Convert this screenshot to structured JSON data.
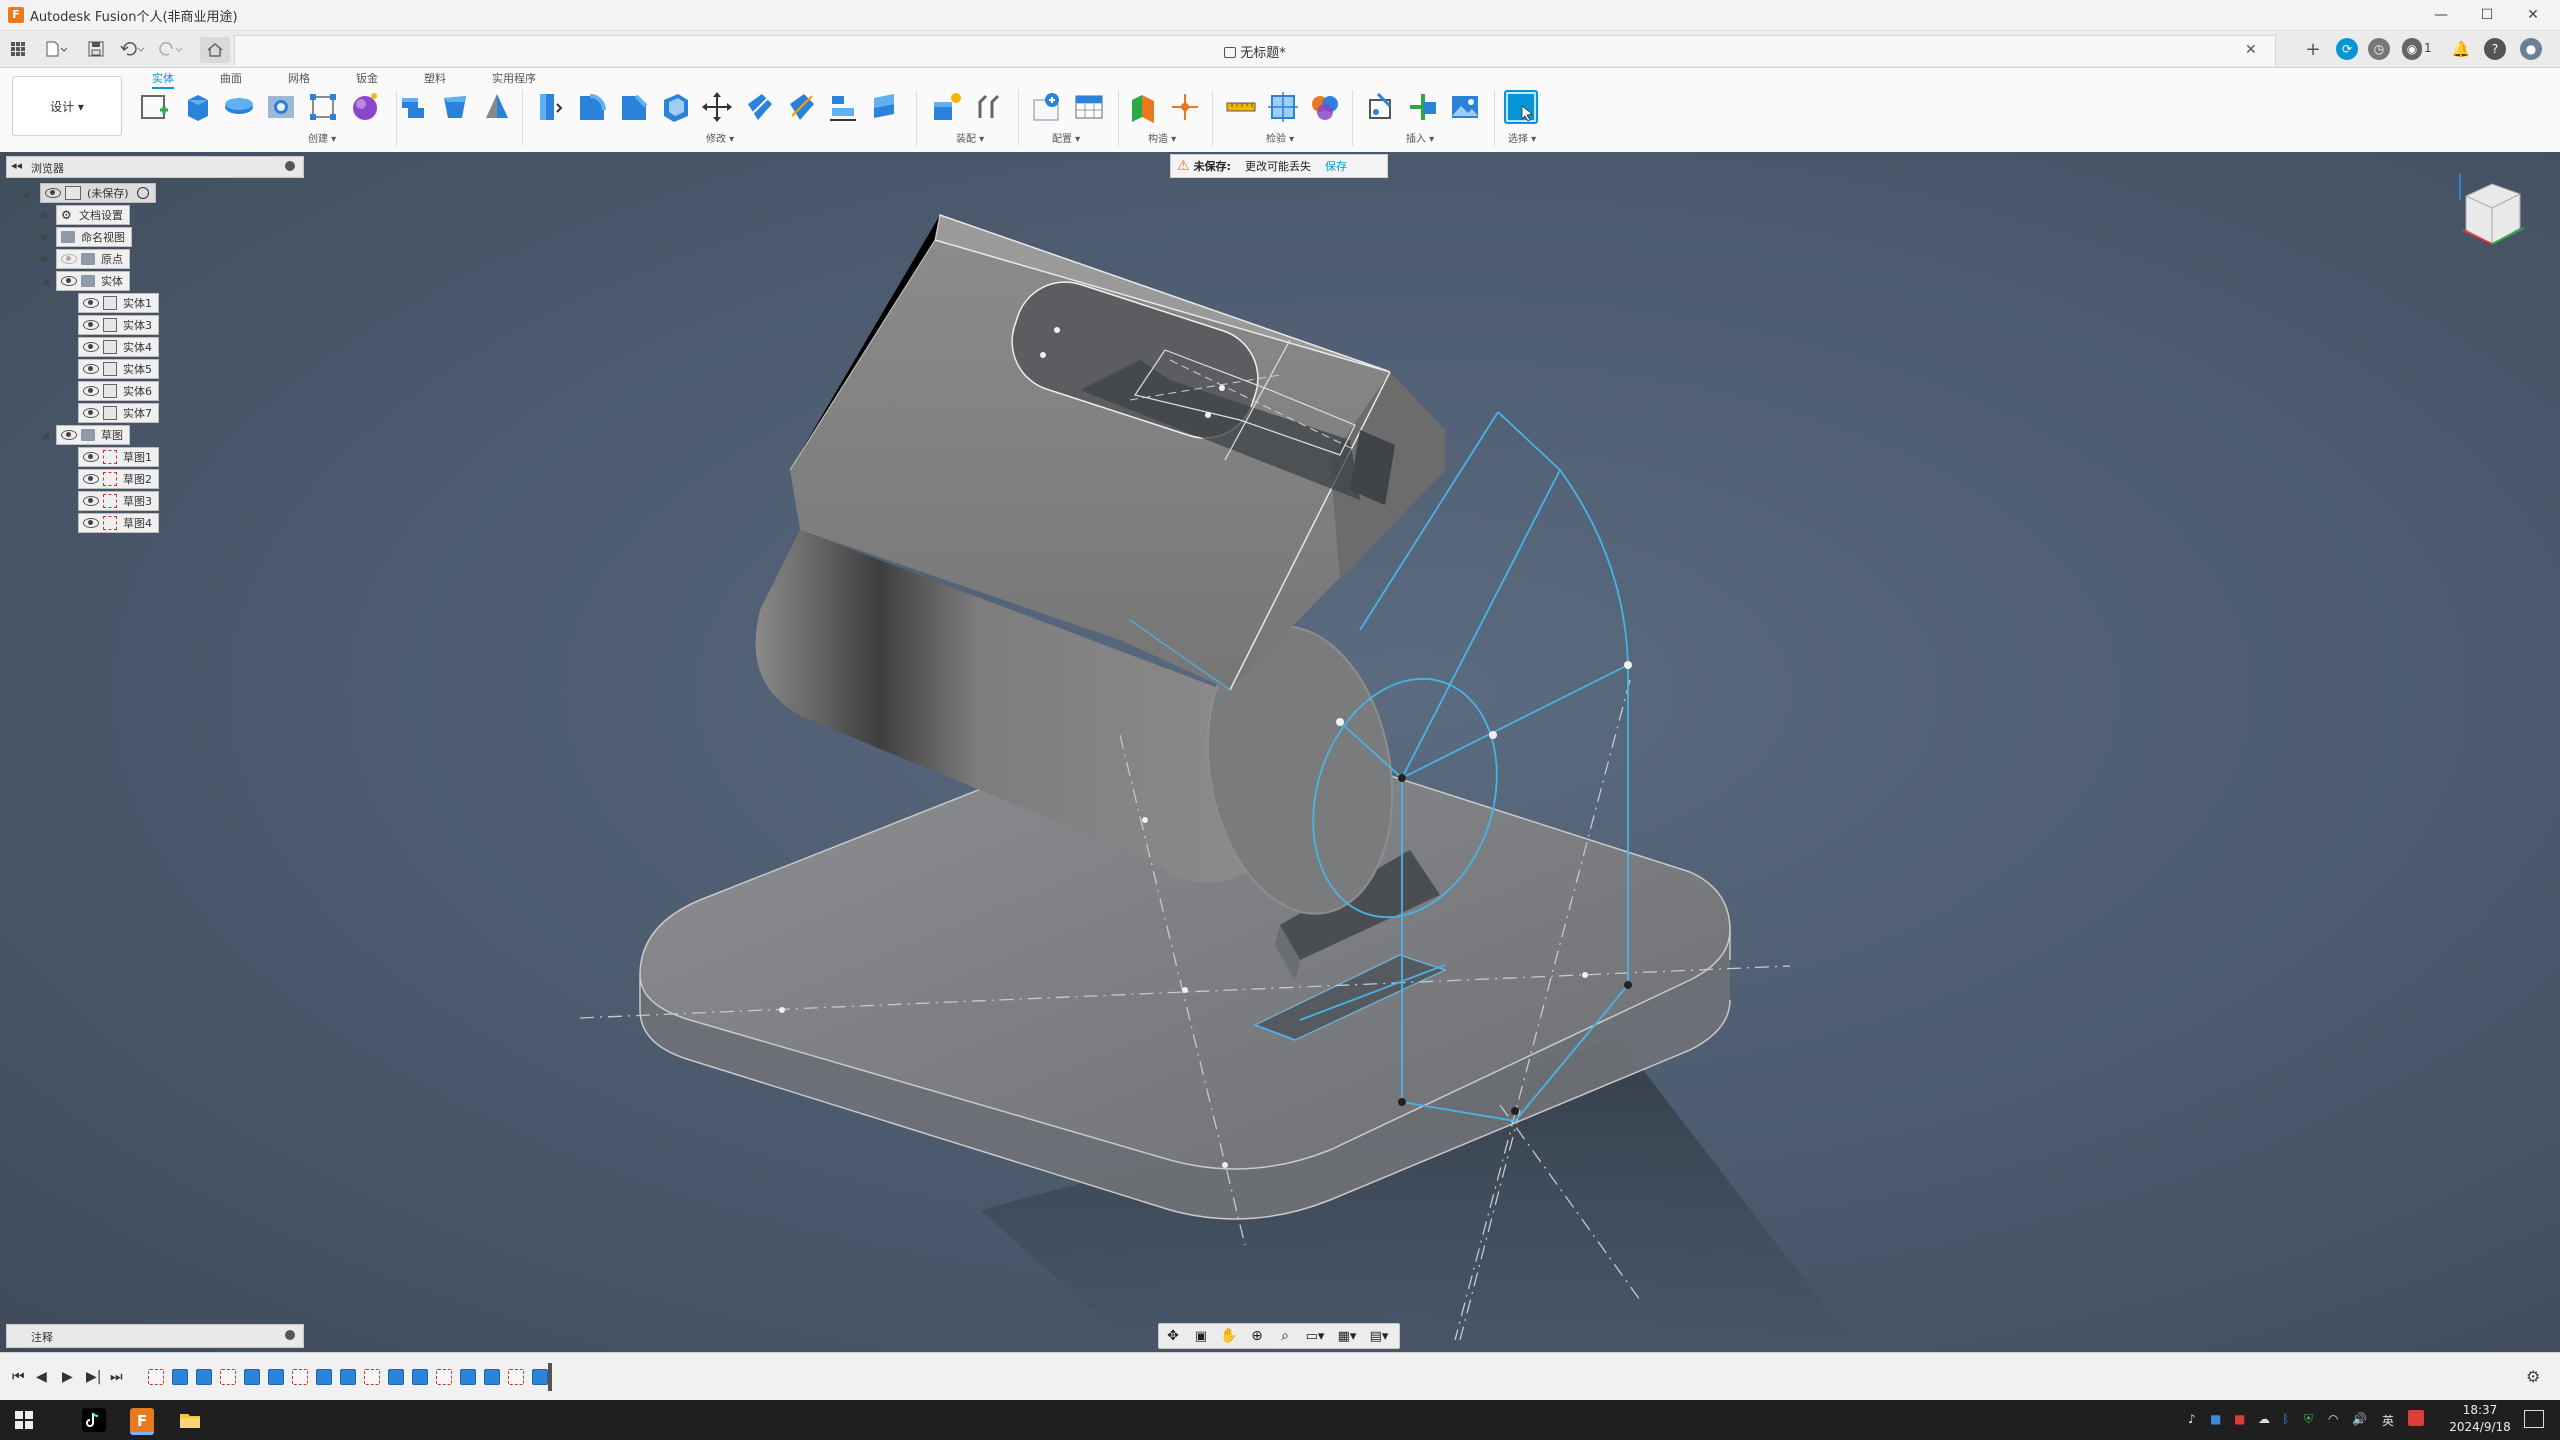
{
  "window": {
    "title": "Autodesk Fusion个人(非商业用途)",
    "logo_letter": "F",
    "controls": [
      "—",
      "☐",
      "✕"
    ]
  },
  "tabbar": {
    "doc_title": "无标题*",
    "lock_icon": "lock-icon",
    "close": "✕",
    "quick_icons": [
      "grid-icon",
      "file-icon",
      "save-icon",
      "undo-icon",
      "redo-icon"
    ],
    "home_icon": "home-icon",
    "right_icons": [
      "plus-icon",
      "sync-icon",
      "clock-icon",
      "jobs-icon",
      "bell-icon",
      "help-icon",
      "user-icon"
    ],
    "jobs_count": "1"
  },
  "ribbon": {
    "workspace": "设计 ▾",
    "tabs": [
      "实体",
      "曲面",
      "网格",
      "钣金",
      "塑料",
      "实用程序"
    ],
    "active_tab": "实体",
    "groups": [
      {
        "label": "创建 ▾",
        "icons": [
          "sketch-icon",
          "extrude-icon",
          "revolve-icon",
          "hole-icon",
          "pattern-icon",
          "form-icon"
        ]
      },
      {
        "label": "修改 ▾",
        "icons": [
          "sweep-icon",
          "loft-icon",
          "mirror-icon",
          "press-pull-icon",
          "fillet-icon",
          "chamfer-icon",
          "shell-icon",
          "combine-icon",
          "move-icon",
          "split-icon",
          "offset-icon",
          "align-icon",
          "replace-icon"
        ]
      },
      {
        "label": "装配 ▾",
        "icons": [
          "new-component-icon",
          "joint-icon"
        ]
      },
      {
        "label": "配置 ▾",
        "icons": [
          "config-icon",
          "table-icon"
        ]
      },
      {
        "label": "构造 ▾",
        "icons": [
          "plane-icon",
          "point-icon"
        ]
      },
      {
        "label": "检验 ▾",
        "icons": [
          "measure-icon",
          "section-icon",
          "zebra-icon"
        ]
      },
      {
        "label": "插入 ▾",
        "icons": [
          "insert-derive-icon",
          "insert-icon",
          "canvas-icon"
        ]
      },
      {
        "label": "选择 ▾",
        "icons": [
          "select-icon"
        ]
      }
    ]
  },
  "browser": {
    "title": "浏览器",
    "root": "(未保存)",
    "items": [
      {
        "label": "文档设置",
        "level": 1,
        "icon": "gear-icon"
      },
      {
        "label": "命名视图",
        "level": 1,
        "icon": "folder-icon"
      },
      {
        "label": "原点",
        "level": 1,
        "icon": "folder-icon"
      },
      {
        "label": "实体",
        "level": 1,
        "icon": "folder-icon"
      },
      {
        "label": "实体1",
        "level": 2,
        "icon": "body-icon"
      },
      {
        "label": "实体3",
        "level": 2,
        "icon": "body-icon"
      },
      {
        "label": "实体4",
        "level": 2,
        "icon": "body-icon"
      },
      {
        "label": "实体5",
        "level": 2,
        "icon": "body-icon"
      },
      {
        "label": "实体6",
        "level": 2,
        "icon": "body-icon"
      },
      {
        "label": "实体7",
        "level": 2,
        "icon": "body-icon"
      },
      {
        "label": "草图",
        "level": 1,
        "icon": "folder-icon"
      },
      {
        "label": "草图1",
        "level": 2,
        "icon": "sketch-icon"
      },
      {
        "label": "草图2",
        "level": 2,
        "icon": "sketch-icon"
      },
      {
        "label": "草图3",
        "level": 2,
        "icon": "sketch-icon"
      },
      {
        "label": "草图4",
        "level": 2,
        "icon": "sketch-icon"
      }
    ]
  },
  "unsaved_banner": {
    "label": "未保存:",
    "message": "更改可能丢失",
    "action": "保存"
  },
  "comments": {
    "title": "注释"
  },
  "navbar": {
    "icons": [
      "orbit-icon",
      "look-at-icon",
      "pan-icon",
      "zoom-icon",
      "fit-icon",
      "display-icon",
      "grid-icon",
      "viewports-icon"
    ]
  },
  "timeline": {
    "controls": [
      "⏮",
      "◀",
      "▶",
      "▶|",
      "⏭"
    ],
    "feature_count": "17"
  },
  "taskbar": {
    "time": "18:37",
    "date": "2024/9/18",
    "ime": "英",
    "tray_icons": [
      "tiktok-icon",
      "app-icon",
      "pdf-icon",
      "cloud-icon",
      "bluetooth-icon",
      "shield-icon",
      "wifi-icon",
      "volume-icon"
    ]
  },
  "colors": {
    "accent": "#0696d7",
    "viewport_bg": "#4b5a6d",
    "sketch_blue": "#49b3e6",
    "model_grey": "#8a8a8a"
  }
}
